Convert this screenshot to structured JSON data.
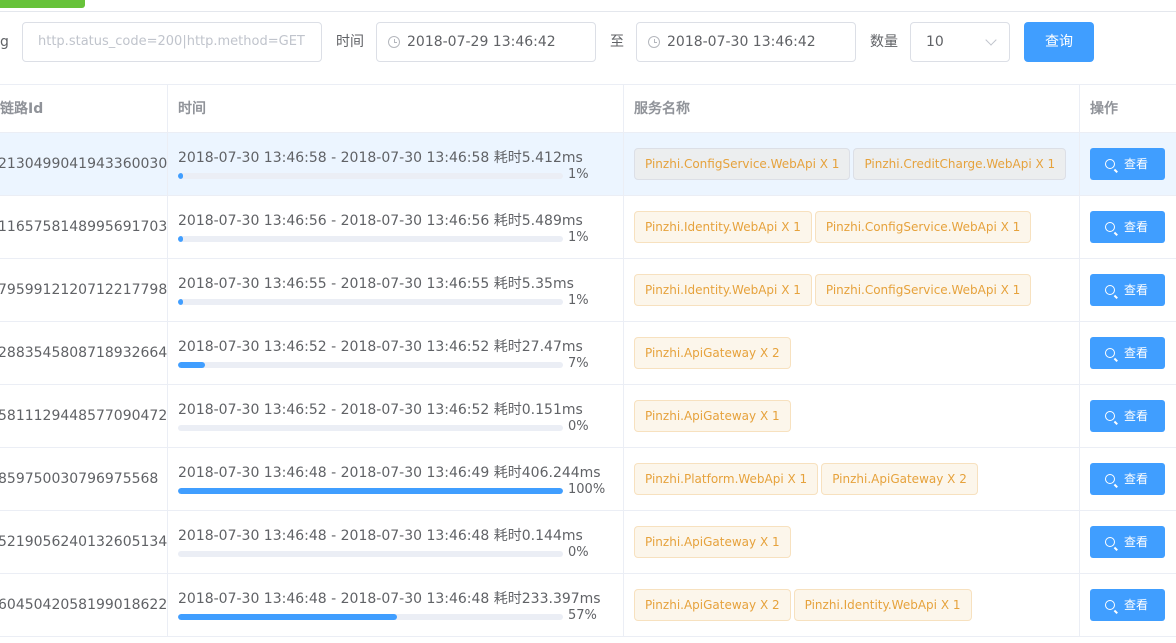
{
  "filter": {
    "tag_label_partial": "g",
    "tag_placeholder": "http.status_code=200|http.method=GET",
    "time_label": "时间",
    "start_time": "2018-07-29 13:46:42",
    "to_label": "至",
    "end_time": "2018-07-30 13:46:42",
    "count_label": "数量",
    "count_value": "10",
    "query_button": "查询"
  },
  "table": {
    "headers": {
      "trace_id": "链路Id",
      "time": "时间",
      "services": "服务名称",
      "actions": "操作"
    },
    "view_label": "查看",
    "rows": [
      {
        "trace_id": "2130499041943360030",
        "time": "2018-07-30 13:46:58 - 2018-07-30 13:46:58 耗时5.412ms",
        "percent": 1,
        "percent_label": "1%",
        "highlighted": true,
        "services": [
          {
            "label": "Pinzhi.ConfigService.WebApi X 1",
            "style": "gray"
          },
          {
            "label": "Pinzhi.CreditCharge.WebApi X 1",
            "style": "gray"
          }
        ]
      },
      {
        "trace_id": "1165758148995691703",
        "time": "2018-07-30 13:46:56 - 2018-07-30 13:46:56 耗时5.489ms",
        "percent": 1,
        "percent_label": "1%",
        "services": [
          {
            "label": "Pinzhi.Identity.WebApi X 1"
          },
          {
            "label": "Pinzhi.ConfigService.WebApi X 1"
          }
        ]
      },
      {
        "trace_id": "7959912120712217798",
        "time": "2018-07-30 13:46:55 - 2018-07-30 13:46:55 耗时5.35ms",
        "percent": 1,
        "percent_label": "1%",
        "services": [
          {
            "label": "Pinzhi.Identity.WebApi X 1"
          },
          {
            "label": "Pinzhi.ConfigService.WebApi X 1"
          }
        ]
      },
      {
        "trace_id": "2883545808718932664",
        "time": "2018-07-30 13:46:52 - 2018-07-30 13:46:52 耗时27.47ms",
        "percent": 7,
        "percent_label": "7%",
        "services": [
          {
            "label": "Pinzhi.ApiGateway X 2"
          }
        ]
      },
      {
        "trace_id": "5811129448577090472",
        "time": "2018-07-30 13:46:52 - 2018-07-30 13:46:52 耗时0.151ms",
        "percent": 0,
        "percent_label": "0%",
        "services": [
          {
            "label": "Pinzhi.ApiGateway X 1"
          }
        ]
      },
      {
        "trace_id": "859750030796975568",
        "time": "2018-07-30 13:46:48 - 2018-07-30 13:46:49 耗时406.244ms",
        "percent": 100,
        "percent_label": "100%",
        "services": [
          {
            "label": "Pinzhi.Platform.WebApi X 1"
          },
          {
            "label": "Pinzhi.ApiGateway X 2"
          }
        ]
      },
      {
        "trace_id": "5219056240132605134",
        "time": "2018-07-30 13:46:48 - 2018-07-30 13:46:48 耗时0.144ms",
        "percent": 0,
        "percent_label": "0%",
        "services": [
          {
            "label": "Pinzhi.ApiGateway X 1"
          }
        ]
      },
      {
        "trace_id": "6045042058199018622",
        "time": "2018-07-30 13:46:48 - 2018-07-30 13:46:48 耗时233.397ms",
        "percent": 57,
        "percent_label": "57%",
        "services": [
          {
            "label": "Pinzhi.ApiGateway X 2"
          },
          {
            "label": "Pinzhi.Identity.WebApi X 1"
          }
        ]
      }
    ]
  },
  "colors": {
    "primary": "#409eff",
    "tag_warning": "#e6a23c",
    "top_tab": "#67c23a"
  }
}
